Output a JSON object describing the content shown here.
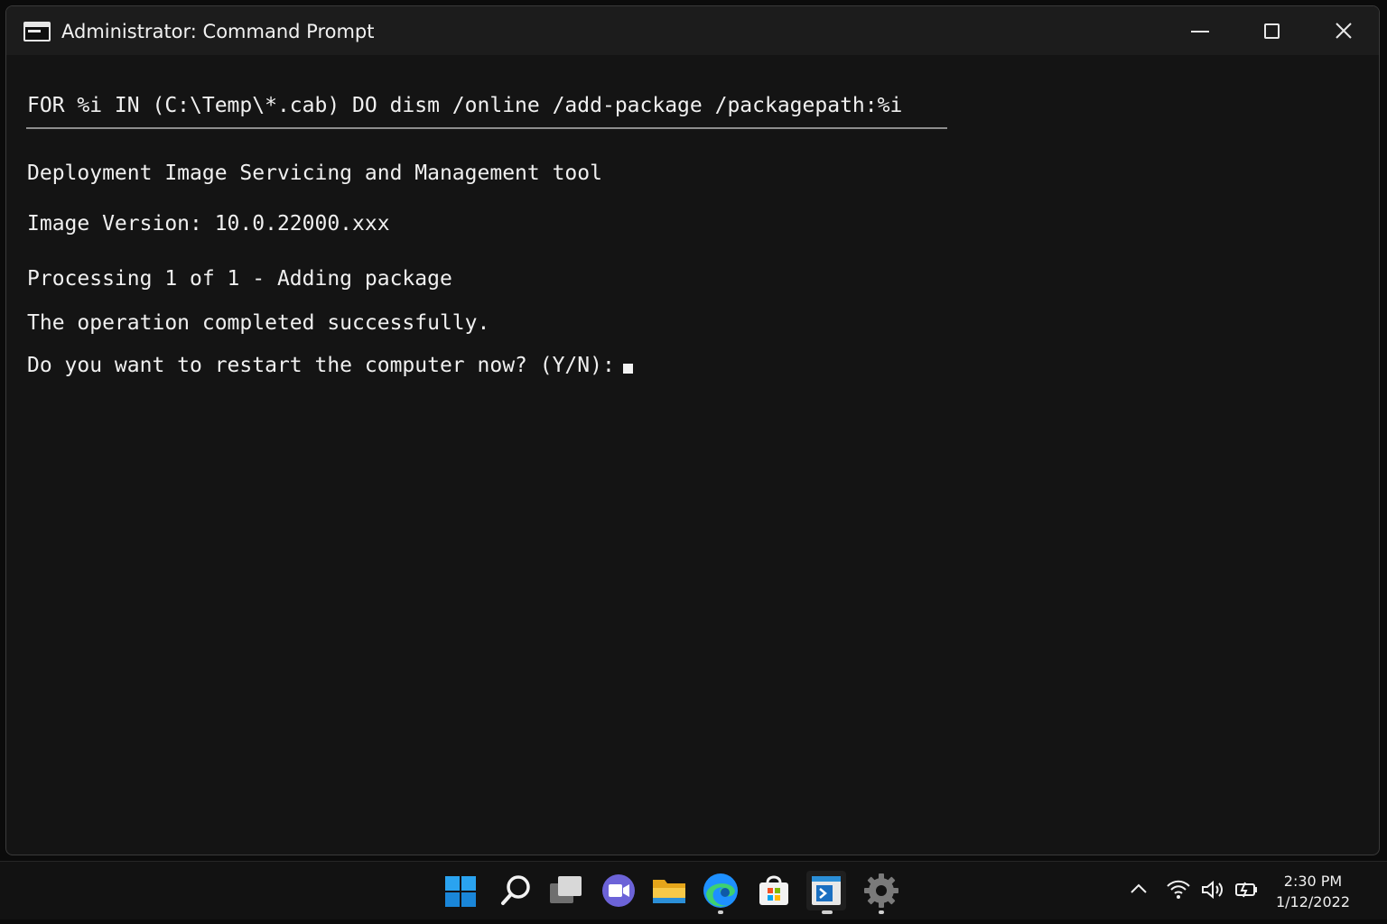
{
  "window": {
    "title": "Administrator: Command Prompt",
    "controls": {
      "minimize": "minimize",
      "maximize": "maximize",
      "close": "close"
    }
  },
  "console": {
    "command": "FOR %i IN (C:\\Temp\\*.cab) DO dism /online /add-package /packagepath:%i",
    "lines": [
      "Deployment Image Servicing and Management tool",
      "Image Version: 10.0.22000.xxx",
      "Processing 1 of 1 - Adding package",
      "The operation completed successfully.",
      "Do you want to restart the computer now? (Y/N):"
    ]
  },
  "taskbar": {
    "apps": [
      {
        "name": "start",
        "icon": "windows-logo-icon"
      },
      {
        "name": "search",
        "icon": "search-icon"
      },
      {
        "name": "task-view",
        "icon": "task-view-icon"
      },
      {
        "name": "chat",
        "icon": "video-chat-icon"
      },
      {
        "name": "file-explorer",
        "icon": "folder-icon"
      },
      {
        "name": "edge",
        "icon": "edge-browser-icon"
      },
      {
        "name": "store",
        "icon": "store-bag-icon"
      },
      {
        "name": "terminal",
        "icon": "terminal-icon",
        "active": true
      },
      {
        "name": "settings",
        "icon": "gear-icon"
      }
    ],
    "tray": {
      "icons": [
        "chevron-up-icon",
        "wifi-icon",
        "speaker-icon",
        "battery-icon"
      ],
      "time": "2:30 PM",
      "date": "1/12/2022"
    }
  },
  "colors": {
    "background": "#141414",
    "text": "#f0f0f0",
    "titlebar": "#1c1c1c",
    "taskbar": "#121212",
    "accent_blue": "#1e90ff"
  }
}
